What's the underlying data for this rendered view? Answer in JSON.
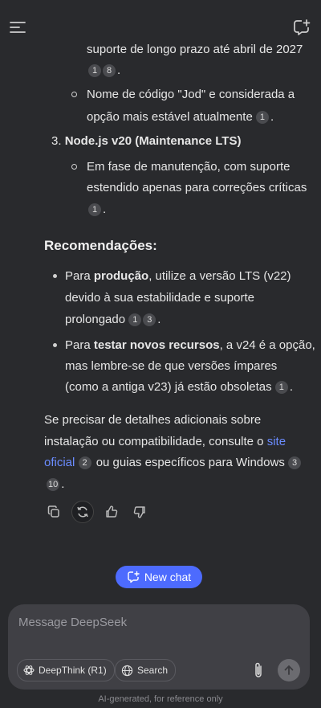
{
  "response": {
    "lines": {
      "l1": "suporte de longo prazo até abril de 2027",
      "l1_end": ".",
      "l2": "Nome de código \"Jod\" e considerada a",
      "l3": "opção mais estável atualmente",
      "l3_end": ".",
      "item3_num": "3.",
      "item3_title": "Node.js v20 (Maintenance LTS)",
      "l4": "Em fase de manutenção, com suporte",
      "l5": "estendido apenas para correções críticas",
      "l6_end": ".",
      "heading": "Recomendações:",
      "r1_a": "Para ",
      "r1_b": "produção",
      "r1_c": ", utilize a versão LTS (v22)",
      "r2": "devido à sua estabilidade e suporte",
      "r3": "prolongado",
      "r3_end": ".",
      "t1_a": "Para ",
      "t1_b": "testar novos recursos",
      "t1_c": ", a v24 é a opção,",
      "t2": "mas lembre-se de que versões ímpares",
      "t3": "(como a antiga v23) já estão obsoletas",
      "t3_end": ".",
      "p1": "Se precisar de detalhes adicionais sobre",
      "p2_a": "instalação ou compatibilidade, consulte o ",
      "p2_link": "site",
      "p3_link": "oficial",
      "p3_b": " ou guias específicos para Windows",
      "p4_end": "."
    },
    "citations": {
      "c1": "1",
      "c2": "8",
      "c3": "1",
      "c4": "1",
      "c5": "1",
      "c6": "3",
      "c7": "1",
      "c8": "2",
      "c9": "3",
      "c10": "10"
    }
  },
  "actions": [
    "copy-icon",
    "regenerate-icon",
    "thumbs-up-icon",
    "thumbs-down-icon"
  ],
  "new_chat_label": "New chat",
  "composer": {
    "placeholder": "Message DeepSeek",
    "deepthink_label": "DeepThink (R1)",
    "search_label": "Search"
  },
  "footer": "AI-generated, for reference only",
  "colors": {
    "accent": "#4d6bfe",
    "link": "#6b8cff",
    "background": "#292a2d"
  }
}
